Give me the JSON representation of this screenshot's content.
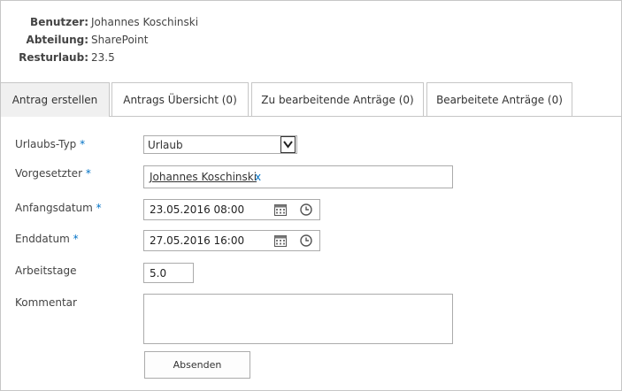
{
  "user_info": {
    "rows": [
      {
        "key": "Benutzer:",
        "value": "Johannes Koschinski"
      },
      {
        "key": "Abteilung:",
        "value": "SharePoint"
      },
      {
        "key": "Resturlaub:",
        "value": "23.5"
      }
    ]
  },
  "tabs": [
    {
      "label": "Antrag erstellen",
      "active": true
    },
    {
      "label": "Antrags Übersicht (0)",
      "active": false
    },
    {
      "label": "Zu bearbeitende Anträge (0)",
      "active": false
    },
    {
      "label": "Bearbeitete Anträge (0)",
      "active": false
    }
  ],
  "form": {
    "leave_type": {
      "label": "Urlaubs-Typ",
      "required": "*",
      "value": "Urlaub"
    },
    "supervisor": {
      "label": "Vorgesetzter",
      "required": "*",
      "value": "Johannes Koschinski",
      "remove": "x"
    },
    "start_date": {
      "label": "Anfangsdatum",
      "required": "*",
      "value": "23.05.2016 08:00"
    },
    "end_date": {
      "label": "Enddatum",
      "required": "*",
      "value": "27.05.2016 16:00"
    },
    "workdays": {
      "label": "Arbeitstage",
      "value": "5.0"
    },
    "comment": {
      "label": "Kommentar",
      "value": ""
    },
    "submit_label": "Absenden"
  },
  "icons": {
    "calendar": "calendar-icon",
    "clock": "clock-icon",
    "dropdown": "chevron-down-icon"
  },
  "colors": {
    "accent": "#0072c6",
    "border": "#ababab",
    "active_tab_bg": "#f0f0f0"
  }
}
